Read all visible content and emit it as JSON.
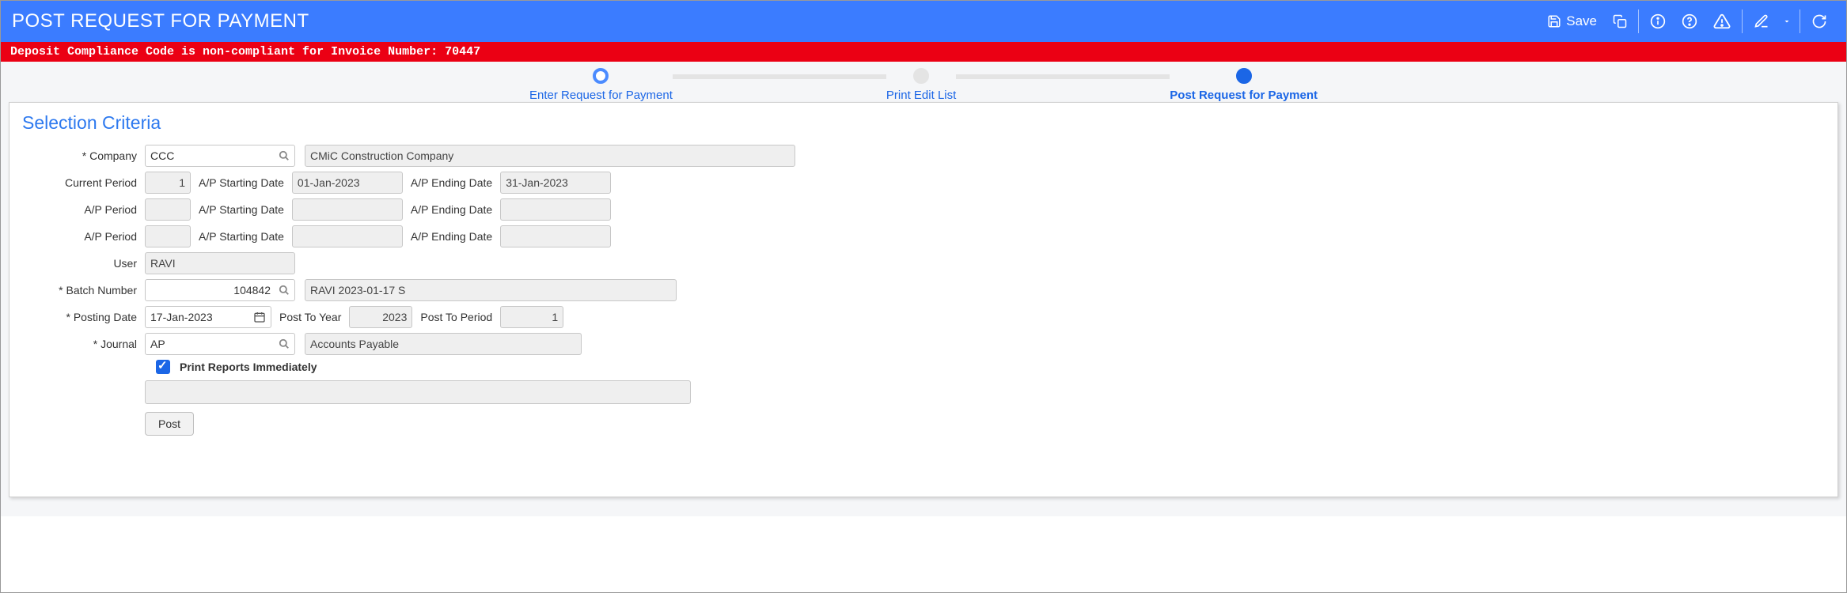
{
  "header": {
    "title": "POST REQUEST FOR PAYMENT",
    "save_label": "Save"
  },
  "alert": {
    "message": "Deposit Compliance Code is non-compliant for Invoice Number: 70447"
  },
  "stepper": {
    "steps": [
      {
        "label": "Enter Request for Payment",
        "state": "open"
      },
      {
        "label": "Print Edit List",
        "state": "neutral"
      },
      {
        "label": "Post Request for Payment",
        "state": "done",
        "current": true
      }
    ]
  },
  "panel": {
    "title": "Selection Criteria"
  },
  "form": {
    "labels": {
      "company": "Company",
      "current_period": "Current Period",
      "ap_period": "A/P Period",
      "ap_starting_date": "A/P Starting Date",
      "ap_ending_date": "A/P Ending Date",
      "user": "User",
      "batch_number": "Batch Number",
      "posting_date": "Posting Date",
      "post_to_year": "Post To Year",
      "post_to_period": "Post To Period",
      "journal": "Journal",
      "print_reports": "Print Reports Immediately",
      "post_button": "Post"
    },
    "values": {
      "company_code": "CCC",
      "company_name": "CMiC Construction Company",
      "current_period": "1",
      "ap_start_1": "01-Jan-2023",
      "ap_end_1": "31-Jan-2023",
      "ap_start_2": "",
      "ap_end_2": "",
      "ap_start_3": "",
      "ap_end_3": "",
      "ap_period_2": "",
      "ap_period_3": "",
      "user": "RAVI",
      "batch_number": "104842",
      "batch_desc": "RAVI 2023-01-17 S",
      "posting_date": "17-Jan-2023",
      "post_to_year": "2023",
      "post_to_period": "1",
      "journal_code": "AP",
      "journal_desc": "Accounts Payable",
      "print_reports_checked": true,
      "status_text": ""
    }
  }
}
